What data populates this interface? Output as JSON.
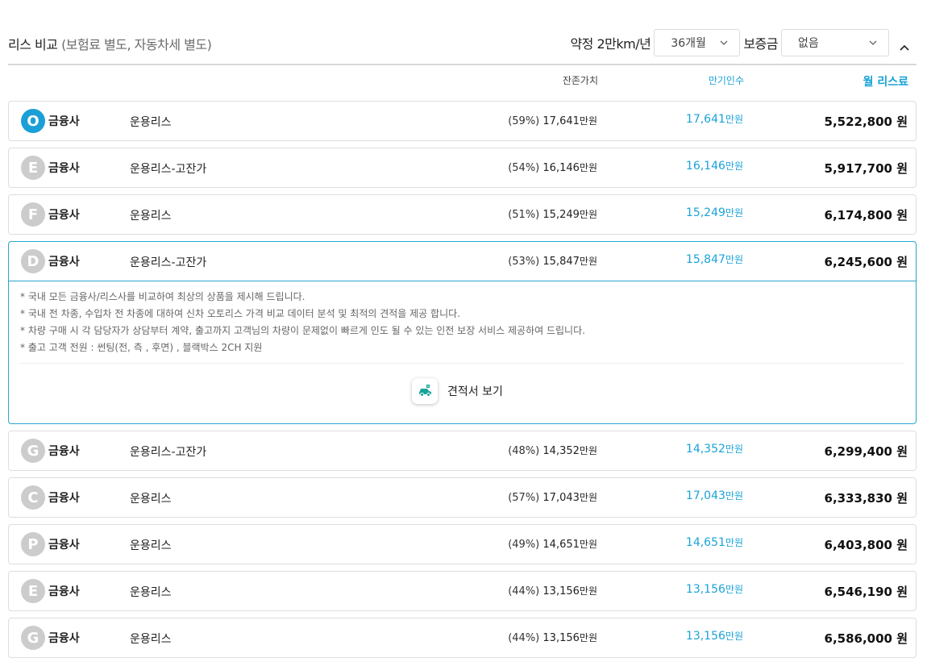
{
  "header": {
    "title_main": "리스 비교",
    "title_sub": "(보험료 별도, 자동차세 별도)",
    "term_label": "약정 2만km/년",
    "term_value": "36개월",
    "deposit_label": "보증금",
    "deposit_value": "없음"
  },
  "columns": {
    "residual": "잔존가치",
    "maturity": "만기인수",
    "monthly": "월 리스료"
  },
  "rows": [
    {
      "badge": "O",
      "lender": "금융사",
      "product": "운용리스",
      "residual_pct": "(59%)",
      "residual_value": "17,641",
      "residual_unit": "만원",
      "maturity_value": "17,641",
      "maturity_unit": "만원",
      "monthly": "5,522,800 원"
    },
    {
      "badge": "E",
      "lender": "금융사",
      "product": "운용리스-고잔가",
      "residual_pct": "(54%)",
      "residual_value": "16,146",
      "residual_unit": "만원",
      "maturity_value": "16,146",
      "maturity_unit": "만원",
      "monthly": "5,917,700 원"
    },
    {
      "badge": "F",
      "lender": "금융사",
      "product": "운용리스",
      "residual_pct": "(51%)",
      "residual_value": "15,249",
      "residual_unit": "만원",
      "maturity_value": "15,249",
      "maturity_unit": "만원",
      "monthly": "6,174,800 원"
    },
    {
      "badge": "D",
      "lender": "금융사",
      "product": "운용리스-고잔가",
      "residual_pct": "(53%)",
      "residual_value": "15,847",
      "residual_unit": "만원",
      "maturity_value": "15,847",
      "maturity_unit": "만원",
      "monthly": "6,245,600 원"
    },
    {
      "badge": "G",
      "lender": "금융사",
      "product": "운용리스-고잔가",
      "residual_pct": "(48%)",
      "residual_value": "14,352",
      "residual_unit": "만원",
      "maturity_value": "14,352",
      "maturity_unit": "만원",
      "monthly": "6,299,400 원"
    },
    {
      "badge": "C",
      "lender": "금융사",
      "product": "운용리스",
      "residual_pct": "(57%)",
      "residual_value": "17,043",
      "residual_unit": "만원",
      "maturity_value": "17,043",
      "maturity_unit": "만원",
      "monthly": "6,333,830 원"
    },
    {
      "badge": "P",
      "lender": "금융사",
      "product": "운용리스",
      "residual_pct": "(49%)",
      "residual_value": "14,651",
      "residual_unit": "만원",
      "maturity_value": "14,651",
      "maturity_unit": "만원",
      "monthly": "6,403,800 원"
    },
    {
      "badge": "E",
      "lender": "금융사",
      "product": "운용리스",
      "residual_pct": "(44%)",
      "residual_value": "13,156",
      "residual_unit": "만원",
      "maturity_value": "13,156",
      "maturity_unit": "만원",
      "monthly": "6,546,190 원"
    },
    {
      "badge": "G",
      "lender": "금융사",
      "product": "운용리스",
      "residual_pct": "(44%)",
      "residual_value": "13,156",
      "residual_unit": "만원",
      "maturity_value": "13,156",
      "maturity_unit": "만원",
      "monthly": "6,586,000 원"
    }
  ],
  "expanded": {
    "notes": [
      "* 국내 모든 금융사/리스사를 비교하여 최상의 상품을 제시해 드립니다.",
      "* 국내 전 차종, 수입차 전 차종에 대하여 신차 오토리스 가격 비교 데이터 분석 및 최적의 견적을 제공 합니다.",
      "* 차량 구매 시 각 담당자가 상담부터 계약, 출고까지 고객님의 차량이 문제없이 빠르게 인도 될 수 있는 인전 보장 서비스 제공하여 드립니다.",
      "* 출고 고객 전원 : 썬팅(전, 측 , 후면) , 블랙박스 2CH 지원"
    ],
    "quote_button": "견적서 보기"
  },
  "colors": {
    "accent": "#1aa3d8",
    "active_border": "#2aa6cf",
    "badge_inactive": "#cccccc",
    "quote_icon": "#1aa39a"
  }
}
